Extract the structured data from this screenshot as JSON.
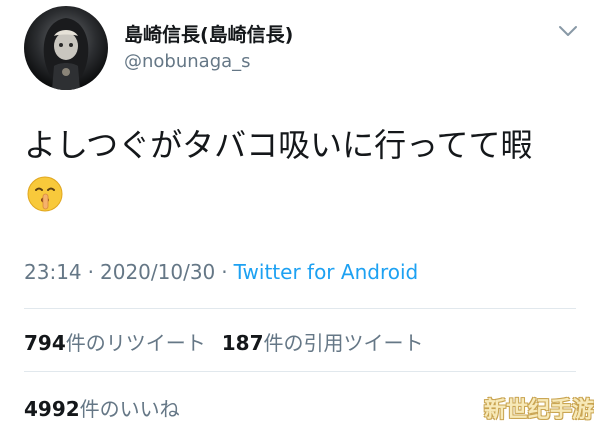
{
  "author": {
    "display_name": "島崎信長(島崎信長)",
    "handle": "@nobunaga_s",
    "avatar": "hooded-figure-avatar"
  },
  "tweet": {
    "text": "よしつぐがタバコ吸いに行ってて暇",
    "emoji": "shushing-face-emoji",
    "time": "23:14",
    "date": "2020/10/30",
    "separator": "·",
    "source": "Twitter for Android"
  },
  "stats": {
    "retweets_count": "794",
    "retweets_label": "件のリツイート",
    "quotes_count": "187",
    "quotes_label": "件の引用ツイート",
    "likes_count": "4992",
    "likes_label": "件のいいね"
  },
  "watermark": "新世纪手游",
  "colors": {
    "text_primary": "#14171a",
    "text_secondary": "#657786",
    "link": "#1da1f2",
    "divider": "#e1e8ed"
  }
}
